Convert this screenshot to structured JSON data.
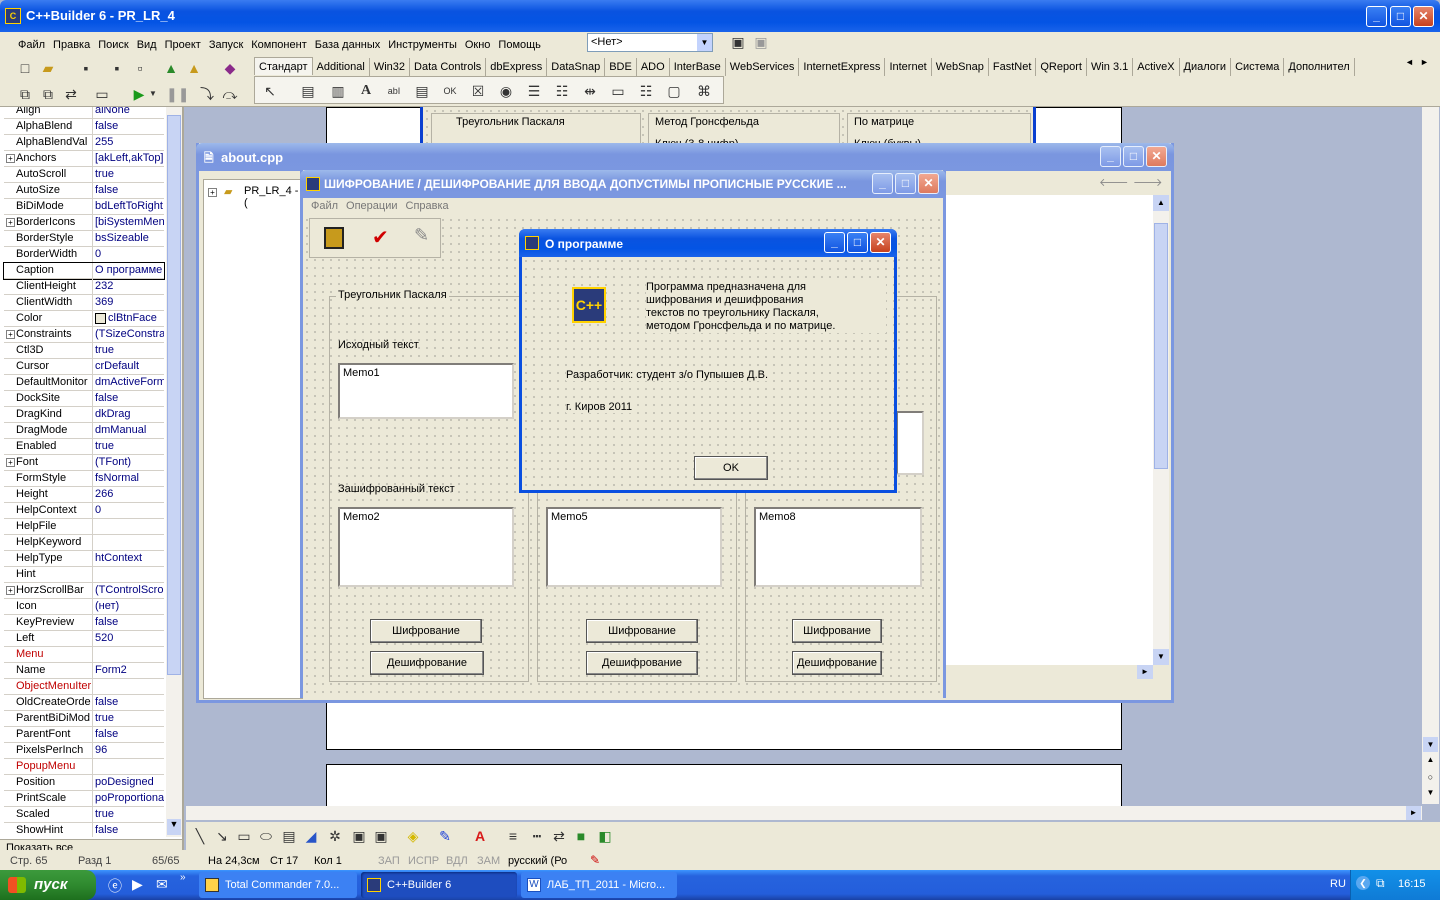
{
  "app": {
    "title": "C++Builder 6 - PR_LR_4"
  },
  "menu": [
    "Файл",
    "Правка",
    "Поиск",
    "Вид",
    "Проект",
    "Запуск",
    "Компонент",
    "База данных",
    "Инструменты",
    "Окно",
    "Помощь"
  ],
  "combo_value": "<Нет>",
  "palette_tabs": [
    "Стандарт",
    "Additional",
    "Win32",
    "Data Controls",
    "dbExpress",
    "DataSnap",
    "BDE",
    "ADO",
    "InterBase",
    "WebServices",
    "InternetExpress",
    "Internet",
    "WebSnap",
    "FastNet",
    "QReport",
    "Win 3.1",
    "ActiveX",
    "Диалоги",
    "Система",
    "Дополнител"
  ],
  "inspector": {
    "rows": [
      {
        "k": "Align",
        "v": "alNone"
      },
      {
        "k": "AlphaBlend",
        "v": "false"
      },
      {
        "k": "AlphaBlendVal",
        "v": "255"
      },
      {
        "k": "Anchors",
        "v": "[akLeft,akTop]",
        "plus": true
      },
      {
        "k": "AutoScroll",
        "v": "true"
      },
      {
        "k": "AutoSize",
        "v": "false"
      },
      {
        "k": "BiDiMode",
        "v": "bdLeftToRight"
      },
      {
        "k": "BorderIcons",
        "v": "[biSystemMenu",
        "plus": true
      },
      {
        "k": "BorderStyle",
        "v": "bsSizeable"
      },
      {
        "k": "BorderWidth",
        "v": "0"
      },
      {
        "k": "Caption",
        "v": "О программе"
      },
      {
        "k": "ClientHeight",
        "v": "232"
      },
      {
        "k": "ClientWidth",
        "v": "369"
      },
      {
        "k": "Color",
        "v": "clBtnFace"
      },
      {
        "k": "Constraints",
        "v": "(TSizeConstrai",
        "plus": true
      },
      {
        "k": "Ctl3D",
        "v": "true"
      },
      {
        "k": "Cursor",
        "v": "crDefault"
      },
      {
        "k": "DefaultMonitor",
        "v": "dmActiveForm"
      },
      {
        "k": "DockSite",
        "v": "false"
      },
      {
        "k": "DragKind",
        "v": "dkDrag"
      },
      {
        "k": "DragMode",
        "v": "dmManual"
      },
      {
        "k": "Enabled",
        "v": "true"
      },
      {
        "k": "Font",
        "v": "(TFont)",
        "plus": true
      },
      {
        "k": "FormStyle",
        "v": "fsNormal"
      },
      {
        "k": "Height",
        "v": "266"
      },
      {
        "k": "HelpContext",
        "v": "0"
      },
      {
        "k": "HelpFile",
        "v": ""
      },
      {
        "k": "HelpKeyword",
        "v": ""
      },
      {
        "k": "HelpType",
        "v": "htContext"
      },
      {
        "k": "Hint",
        "v": ""
      },
      {
        "k": "HorzScrollBar",
        "v": "(TControlScroll",
        "plus": true
      },
      {
        "k": "Icon",
        "v": "(нет)"
      },
      {
        "k": "KeyPreview",
        "v": "false"
      },
      {
        "k": "Left",
        "v": "520"
      },
      {
        "k": "Menu",
        "v": "",
        "red": true
      },
      {
        "k": "Name",
        "v": "Form2"
      },
      {
        "k": "ObjectMenuIter",
        "v": "",
        "red": true
      },
      {
        "k": "OldCreateOrde",
        "v": "false"
      },
      {
        "k": "ParentBiDiMod",
        "v": "true"
      },
      {
        "k": "ParentFont",
        "v": "false"
      },
      {
        "k": "PixelsPerInch",
        "v": "96"
      },
      {
        "k": "PopupMenu",
        "v": "",
        "red": true
      },
      {
        "k": "Position",
        "v": "poDesigned"
      },
      {
        "k": "PrintScale",
        "v": "poProportional"
      },
      {
        "k": "Scaled",
        "v": "true"
      },
      {
        "k": "ShowHint",
        "v": "false"
      }
    ],
    "footer": "Показать все"
  },
  "bg_form": {
    "groups": [
      "Треугольник Паскаля",
      "Метод Гронсфельда",
      "По матрице"
    ],
    "sub": [
      "Ключ (3-8 цифр)",
      "Ключ (буквы)"
    ]
  },
  "editor": {
    "title": "about.cpp",
    "tree_item": "PR_LR_4 - ("
  },
  "main_form": {
    "title": "ШИФРОВАНИЕ / ДЕШИФРОВАНИЕ    ДЛЯ ВВОДА ДОПУСТИМЫ ПРОПИСНЫЕ РУССКИЕ ...",
    "menu": [
      "Файл",
      "Операции",
      "Справка"
    ],
    "group1": "Треугольник Паскаля",
    "src_label": "Исходный текст",
    "enc_label": "Зашифрованный текст",
    "memos": [
      "Memo1",
      "Memo2",
      "Memo5",
      "Memo8"
    ],
    "encrypt": "Шифрование",
    "decrypt": "Дешифрование"
  },
  "about": {
    "title": "О программе",
    "desc": "Программа предназначена для\nшифрования и дешифрования\nтекстов по треугольнику Паскаля,\nметодом Гронсфельда и по матрице.",
    "author": "Разработчик: студент з/о Пупышев Д.В.",
    "place": "г. Киров 2011",
    "ok": "OK"
  },
  "status": {
    "page": "Стр. 65",
    "section": "Разд 1",
    "pages": "65/65",
    "pos": "На 24,3см",
    "row": "Ст 17",
    "col": "Кол 1",
    "rec": "ЗАП",
    "fix": "ИСПР",
    "ext": "ВДЛ",
    "ovr": "ЗАМ",
    "lang": "русский (Ро"
  },
  "taskbar": {
    "start": "пуск",
    "items": [
      "Total Commander 7.0...",
      "C++Builder 6",
      "ЛАБ_ТП_2011 - Micro..."
    ],
    "lang": "RU",
    "time": "16:15"
  }
}
